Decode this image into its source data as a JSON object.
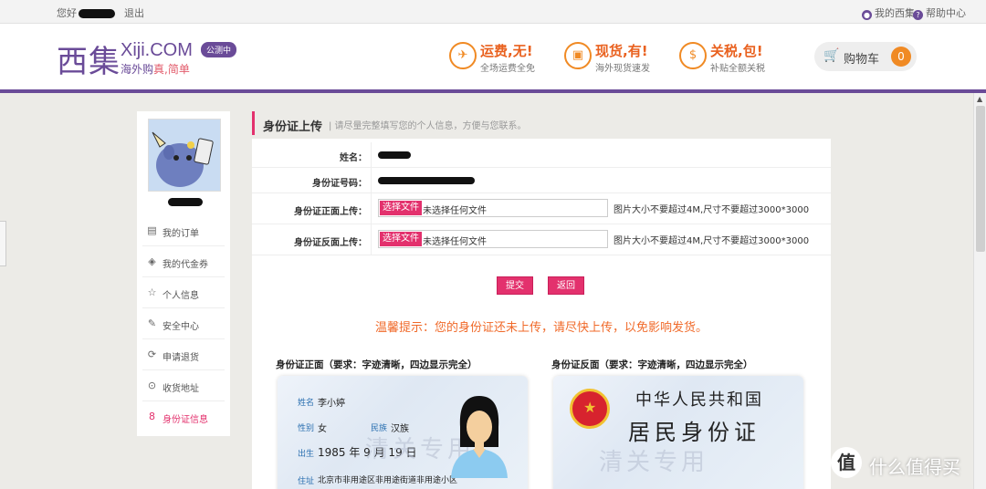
{
  "topbar": {
    "greeting": "您好",
    "logout": "退出",
    "my_xiji": "我的西集",
    "help": "帮助中心"
  },
  "header": {
    "logo_zh": "西集",
    "logo_en": "Xiji.COM",
    "tag_a": "海外购",
    "tag_b": "真,简单",
    "beta": "公测中",
    "features": [
      {
        "icon": "plane-icon",
        "glyph": "✈",
        "title": "运费,无!",
        "sub": "全场运费全免"
      },
      {
        "icon": "bag-icon",
        "glyph": "▣",
        "title": "现货,有!",
        "sub": "海外现货速发"
      },
      {
        "icon": "money-icon",
        "glyph": "$",
        "title": "关税,包!",
        "sub": "补贴全额关税"
      }
    ],
    "cart_label": "购物车",
    "cart_count": "0"
  },
  "sidebar": {
    "items": [
      {
        "label": "我的订单",
        "icon": "order-icon",
        "glyph": "▤"
      },
      {
        "label": "我的代金券",
        "icon": "coupon-icon",
        "glyph": "◈"
      },
      {
        "label": "个人信息",
        "icon": "star-icon",
        "glyph": "☆"
      },
      {
        "label": "安全中心",
        "icon": "edit-icon",
        "glyph": "✎"
      },
      {
        "label": "申请退货",
        "icon": "return-icon",
        "glyph": "⟳"
      },
      {
        "label": "收货地址",
        "icon": "pin-icon",
        "glyph": "⊙"
      },
      {
        "label": "身份证信息",
        "icon": "id-icon",
        "glyph": "8"
      }
    ]
  },
  "section": {
    "title": "身份证上传",
    "subtitle": "| 请尽量完整填写您的个人信息，方便与您联系。"
  },
  "form": {
    "name_label": "姓名：",
    "idno_label": "身份证号码：",
    "front_label": "身份证正面上传：",
    "back_label": "身份证反面上传：",
    "choose_file": "选择文件",
    "no_file": "未选择任何文件",
    "size_hint": "图片大小不要超过4M,尺寸不要超过3000*3000"
  },
  "buttons": {
    "submit": "提交",
    "back": "返回"
  },
  "notice": "温馨提示：您的身份证还未上传，请尽快上传，以免影响发货。",
  "cards": {
    "front_title": "身份证正面（要求：字迹清晰，四边显示完全）",
    "back_title": "身份证反面（要求：字迹清晰，四边显示完全）",
    "front": {
      "name_f": "姓名",
      "name_v": "李小婷",
      "sex_f": "性别",
      "sex_v": "女",
      "nation_f": "民族",
      "nation_v": "汉族",
      "birth_f": "出生",
      "birth_v": "1985 年  9 月 19 日",
      "addr_f": "住址",
      "addr_v": "北京市非用途区非用途街道非用途小区",
      "wm": "清关专用"
    },
    "back": {
      "country": "中华人民共和国",
      "idcard": "居民身份证",
      "wm": "清关专用"
    }
  },
  "overlay": {
    "brand": "什么值得买",
    "logo_glyph": "值"
  }
}
